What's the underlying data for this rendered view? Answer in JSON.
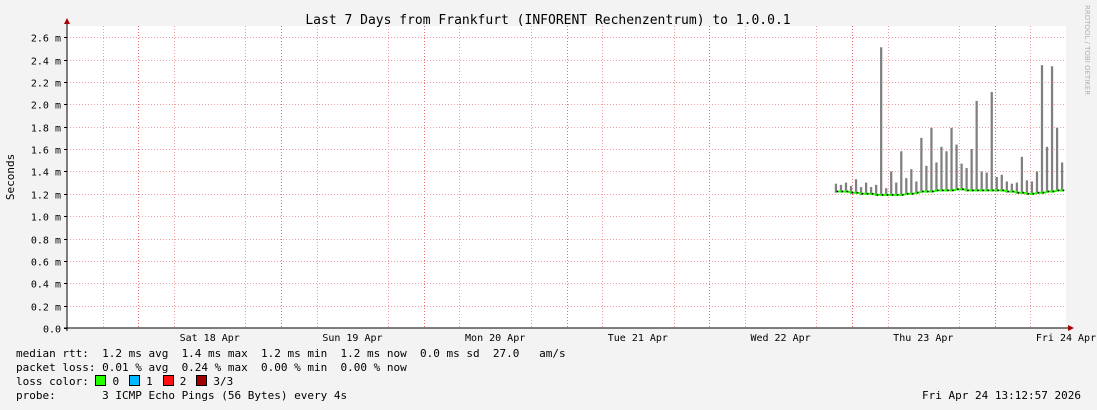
{
  "watermark": "RRDTOOL / TOBI OETIKER",
  "chart_data": {
    "type": "area",
    "title": "Last 7 Days from Frankfurt (INFORENT Rechenzentrum) to 1.0.0.1",
    "ylabel": "Seconds",
    "xlabel": "",
    "yunit": "m",
    "ylim": [
      0,
      2.7
    ],
    "yticks": [
      0.0,
      0.2,
      0.4,
      0.6,
      0.8,
      1.0,
      1.2,
      1.4,
      1.6,
      1.8,
      2.0,
      2.2,
      2.4,
      2.6
    ],
    "ytick_labels": [
      "0.0",
      "0.2 m",
      "0.4 m",
      "0.6 m",
      "0.8 m",
      "1.0 m",
      "1.2 m",
      "1.4 m",
      "1.6 m",
      "1.8 m",
      "2.0 m",
      "2.2 m",
      "2.4 m",
      "2.6 m"
    ],
    "xlim_days": [
      0,
      7
    ],
    "x_tick_labels": [
      {
        "day": 1.0,
        "label": "Sat 18 Apr"
      },
      {
        "day": 2.0,
        "label": "Sun 19 Apr"
      },
      {
        "day": 3.0,
        "label": "Mon 20 Apr"
      },
      {
        "day": 4.0,
        "label": "Tue 21 Apr"
      },
      {
        "day": 5.0,
        "label": "Wed 22 Apr"
      },
      {
        "day": 6.0,
        "label": "Thu 23 Apr"
      },
      {
        "day": 7.0,
        "label": "Fri 24 Apr"
      }
    ],
    "grid": true,
    "colors": {
      "background": "#ffffff",
      "canvas_border": "#f3f3f3",
      "grid": "#f0a0a0",
      "major_grid": "#e07070",
      "smoke": "#808080",
      "median_ok": "#26ff00",
      "axis_arrow": "#aa0000"
    },
    "series": [
      {
        "name": "median rtt",
        "x_start_day": 5.38,
        "x_end_day": 7.0,
        "median_ms": [
          1.22,
          1.22,
          1.22,
          1.21,
          1.21,
          1.2,
          1.2,
          1.2,
          1.19,
          1.19,
          1.19,
          1.19,
          1.19,
          1.19,
          1.2,
          1.2,
          1.21,
          1.22,
          1.22,
          1.22,
          1.23,
          1.23,
          1.23,
          1.23,
          1.24,
          1.24,
          1.23,
          1.23,
          1.23,
          1.23,
          1.23,
          1.23,
          1.23,
          1.23,
          1.22,
          1.22,
          1.21,
          1.21,
          1.2,
          1.2,
          1.21,
          1.21,
          1.22,
          1.22,
          1.23,
          1.23
        ],
        "max_ms": [
          1.29,
          1.28,
          1.3,
          1.27,
          1.33,
          1.26,
          1.3,
          1.26,
          1.28,
          2.51,
          1.25,
          1.4,
          1.3,
          1.58,
          1.34,
          1.42,
          1.31,
          1.7,
          1.45,
          1.79,
          1.48,
          1.62,
          1.58,
          1.79,
          1.64,
          1.47,
          1.43,
          1.6,
          2.03,
          1.4,
          1.39,
          2.11,
          1.35,
          1.37,
          1.31,
          1.29,
          1.3,
          1.53,
          1.32,
          1.31,
          1.4,
          2.35,
          1.62,
          2.34,
          1.79,
          1.48
        ],
        "min_ms": [
          1.21,
          1.21,
          1.21,
          1.2,
          1.2,
          1.19,
          1.19,
          1.19,
          1.18,
          1.18,
          1.18,
          1.18,
          1.18,
          1.18,
          1.19,
          1.19,
          1.2,
          1.21,
          1.21,
          1.21,
          1.22,
          1.22,
          1.22,
          1.22,
          1.23,
          1.23,
          1.22,
          1.22,
          1.22,
          1.22,
          1.22,
          1.22,
          1.22,
          1.22,
          1.21,
          1.21,
          1.2,
          1.2,
          1.19,
          1.19,
          1.2,
          1.2,
          1.21,
          1.21,
          1.22,
          1.22
        ]
      }
    ]
  },
  "legend": {
    "median_line": "median rtt:  1.2 ms avg  1.4 ms max  1.2 ms min  1.2 ms now  0.0 ms sd  27.0   am/s",
    "loss_line": "packet loss: 0.01 % avg  0.24 % max  0.00 % min  0.00 % now",
    "loss_color_label": "loss color:",
    "loss_items": [
      {
        "label": "0",
        "color": "#26ff00"
      },
      {
        "label": "1",
        "color": "#00b8ff"
      },
      {
        "label": "2",
        "color": "#ff1010"
      },
      {
        "label": "3/3",
        "color": "#a00000"
      }
    ],
    "probe_line": "probe:       3 ICMP Echo Pings (56 Bytes) every 4s",
    "timestamp": "Fri Apr 24 13:12:57 2026"
  }
}
